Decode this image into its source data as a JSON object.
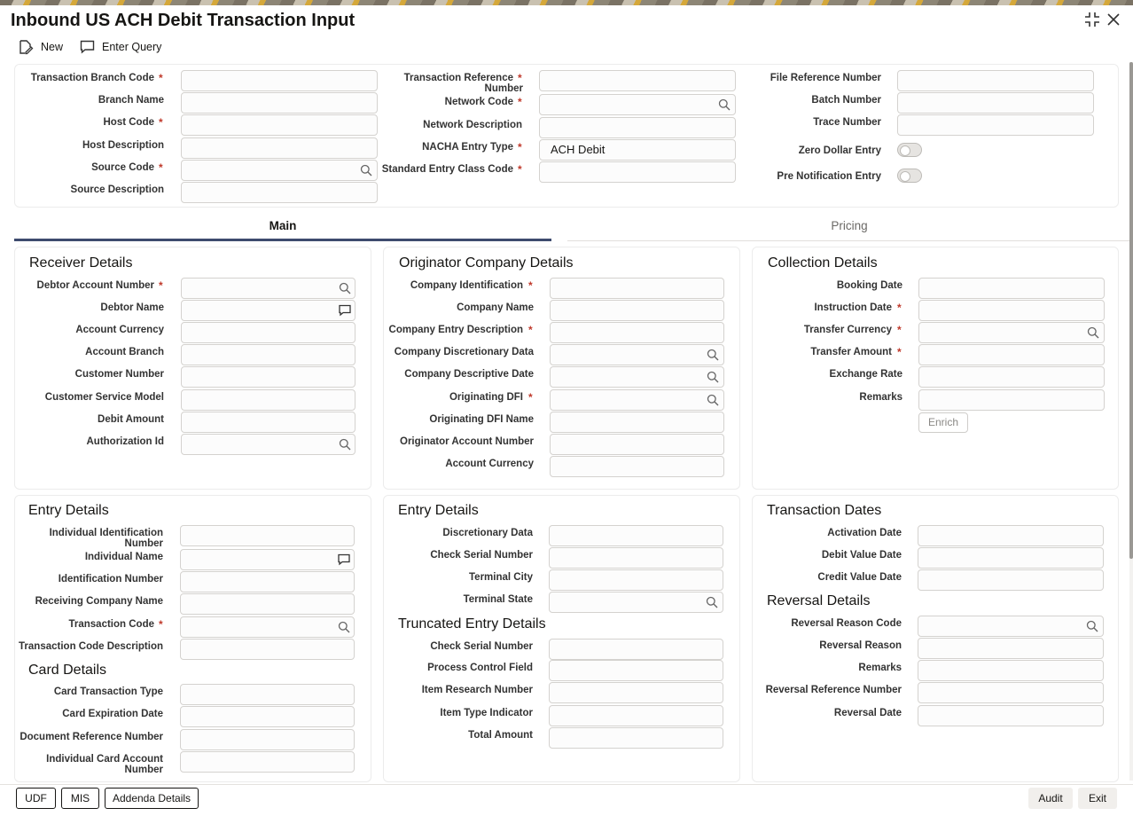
{
  "window": {
    "title": "Inbound US ACH Debit Transaction Input",
    "controls": [
      {
        "name": "minimize-icon",
        "glyph": "⤡"
      },
      {
        "name": "close-icon",
        "glyph": "✕"
      }
    ]
  },
  "toolbar": {
    "new_label": "New",
    "enter_query_label": "Enter Query"
  },
  "header_fields": {
    "col1": [
      {
        "label": "Transaction Branch Code",
        "required": true,
        "value": ""
      },
      {
        "label": "Branch Name",
        "required": false,
        "value": ""
      },
      {
        "label": "Host Code",
        "required": true,
        "value": ""
      },
      {
        "label": "Host Description",
        "required": false,
        "value": ""
      },
      {
        "label": "Source Code",
        "required": true,
        "value": "",
        "icon": "search-icon"
      },
      {
        "label": "Source Description",
        "required": false,
        "value": ""
      }
    ],
    "col2": [
      {
        "label": "Transaction Reference Number",
        "label_line1": "Transaction Reference",
        "label_line2": "Number",
        "required": true,
        "value": ""
      },
      {
        "label": "Network Code",
        "required": true,
        "value": "",
        "icon": "search-icon"
      },
      {
        "label": "Network Description",
        "required": false,
        "value": ""
      },
      {
        "label": "NACHA Entry Type",
        "required": true,
        "value": "ACH Debit"
      },
      {
        "label": "Standard Entry Class Code",
        "required": true,
        "value": ""
      }
    ],
    "col3": [
      {
        "label": "File Reference Number",
        "value": ""
      },
      {
        "label": "Batch Number",
        "value": ""
      },
      {
        "label": "Trace Number",
        "value": ""
      },
      {
        "label": "Zero Dollar Entry",
        "toggle": false
      },
      {
        "label": "Pre Notification Entry",
        "toggle": false
      }
    ]
  },
  "tabs": [
    {
      "label": "Main",
      "active": true
    },
    {
      "label": "Pricing",
      "active": false
    }
  ],
  "receiver_details": {
    "title": "Receiver Details",
    "fields": [
      {
        "label": "Debtor Account Number",
        "required": true,
        "value": "",
        "icon": "search-icon"
      },
      {
        "label": "Debtor Name",
        "required": false,
        "value": "",
        "icon": "comment-icon"
      },
      {
        "label": "Account Currency",
        "value": ""
      },
      {
        "label": "Account Branch",
        "value": ""
      },
      {
        "label": "Customer Number",
        "value": ""
      },
      {
        "label": "Customer Service Model",
        "value": ""
      },
      {
        "label": "Debit Amount",
        "value": ""
      },
      {
        "label": "Authorization Id",
        "value": "",
        "icon": "search-icon"
      }
    ]
  },
  "originator_company_details": {
    "title": "Originator Company Details",
    "fields": [
      {
        "label": "Company Identification",
        "required": true,
        "value": ""
      },
      {
        "label": "Company Name",
        "value": ""
      },
      {
        "label": "Company Entry Description",
        "required": true,
        "value": ""
      },
      {
        "label": "Company Discretionary Data",
        "value": "",
        "icon": "search-icon"
      },
      {
        "label": "Company Descriptive Date",
        "value": "",
        "icon": "search-icon"
      },
      {
        "label": "Originating DFI",
        "required": true,
        "value": "",
        "icon": "search-icon"
      },
      {
        "label": "Originating DFI Name",
        "value": ""
      },
      {
        "label": "Originator Account Number",
        "value": ""
      },
      {
        "label": "Account Currency",
        "value": ""
      }
    ]
  },
  "collection_details": {
    "title": "Collection Details",
    "fields": [
      {
        "label": "Booking Date",
        "value": ""
      },
      {
        "label": "Instruction Date",
        "required": true,
        "value": ""
      },
      {
        "label": "Transfer Currency",
        "required": true,
        "value": "",
        "icon": "search-icon"
      },
      {
        "label": "Transfer Amount",
        "required": true,
        "value": ""
      },
      {
        "label": "Exchange Rate",
        "value": ""
      },
      {
        "label": "Remarks",
        "value": ""
      }
    ],
    "enrich_label": "Enrich"
  },
  "entry_details_left": {
    "title": "Entry Details",
    "fields": [
      {
        "label": "Individual Identification Number",
        "label_line1": "Individual Identification",
        "label_line2": "Number",
        "value": ""
      },
      {
        "label": "Individual Name",
        "value": "",
        "icon": "comment-icon"
      },
      {
        "label": "Identification Number",
        "value": ""
      },
      {
        "label": "Receiving Company Name",
        "value": ""
      },
      {
        "label": "Transaction Code",
        "required": true,
        "value": "",
        "icon": "search-icon"
      },
      {
        "label": "Transaction Code Description",
        "value": ""
      }
    ]
  },
  "card_details": {
    "title": "Card Details",
    "fields": [
      {
        "label": "Card Transaction Type",
        "value": ""
      },
      {
        "label": "Card Expiration Date",
        "value": ""
      },
      {
        "label": "Document Reference Number",
        "value": ""
      },
      {
        "label": "Individual Card Account Number",
        "label_line1": "Individual Card Account",
        "label_line2": "Number",
        "value": ""
      }
    ]
  },
  "entry_details_mid": {
    "title": "Entry Details",
    "fields": [
      {
        "label": "Discretionary Data",
        "value": ""
      },
      {
        "label": "Check Serial Number",
        "value": ""
      },
      {
        "label": "Terminal City",
        "value": ""
      },
      {
        "label": "Terminal State",
        "value": "",
        "icon": "search-icon"
      }
    ]
  },
  "truncated_entry_details": {
    "title": "Truncated Entry Details",
    "fields": [
      {
        "label": "Check Serial Number",
        "value": ""
      },
      {
        "label": "Process Control Field",
        "value": ""
      },
      {
        "label": "Item Research Number",
        "value": ""
      },
      {
        "label": "Item Type Indicator",
        "value": ""
      },
      {
        "label": "Total Amount",
        "value": ""
      }
    ]
  },
  "transaction_dates": {
    "title": "Transaction Dates",
    "fields": [
      {
        "label": "Activation Date",
        "value": ""
      },
      {
        "label": "Debit Value Date",
        "value": ""
      },
      {
        "label": "Credit Value Date",
        "value": ""
      }
    ]
  },
  "reversal_details": {
    "title": "Reversal Details",
    "fields": [
      {
        "label": "Reversal Reason Code",
        "value": "",
        "icon": "search-icon"
      },
      {
        "label": "Reversal Reason",
        "value": ""
      },
      {
        "label": "Remarks",
        "value": ""
      },
      {
        "label": "Reversal Reference Number",
        "value": ""
      },
      {
        "label": "Reversal Date",
        "value": ""
      }
    ]
  },
  "footer": {
    "udf_label": "UDF",
    "mis_label": "MIS",
    "addenda_label": "Addenda Details",
    "audit_label": "Audit",
    "exit_label": "Exit"
  },
  "colors": {
    "required_marker": "#c0392b",
    "active_tab_underline": "#3e4b6e",
    "input_border": "#d4d2cf"
  }
}
